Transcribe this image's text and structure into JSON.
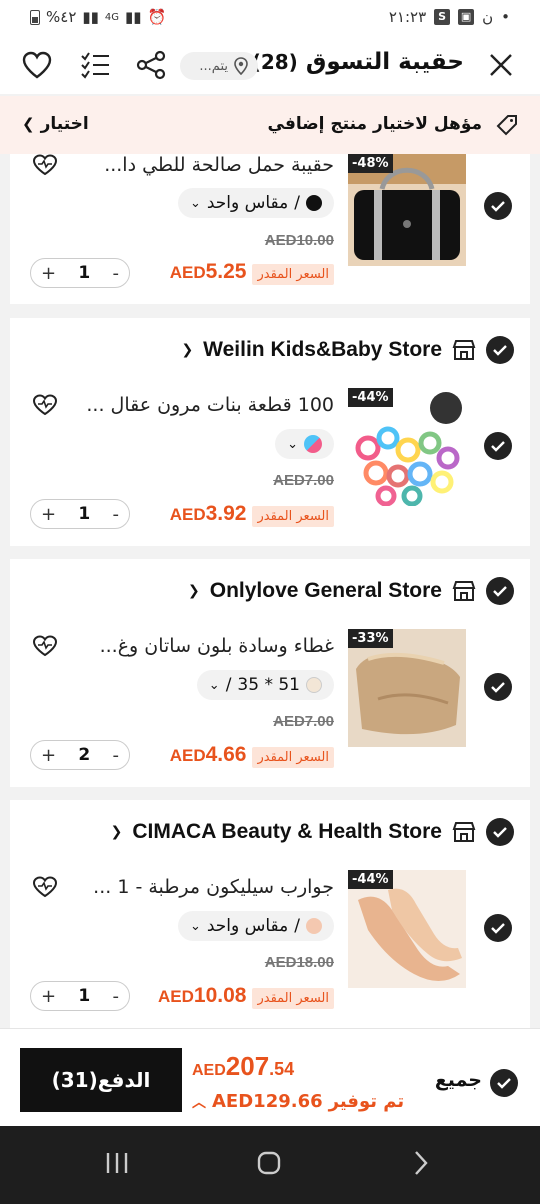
{
  "status_bar": {
    "time": "٢١:٢٣",
    "battery": "%٤٢",
    "signal": "4G"
  },
  "header": {
    "title": "حقيبة التسوق",
    "count": "(28)",
    "location_placeholder": "يتم...",
    "icons": [
      "close-icon",
      "share-icon",
      "list-icon",
      "heart-icon",
      "location-icon"
    ]
  },
  "banner": {
    "text": "مؤهل لاختيار منتج إضافي",
    "choose": "اختيار"
  },
  "items": [
    {
      "title": "حقيبة حمل صالحة للطي دا...",
      "discount": "-48%",
      "variant": "مقاس واحد",
      "variant_sep": "/",
      "original_price": "AED10.00",
      "currency": "AED",
      "price": "5.25",
      "est_label": "السعر المقدر",
      "qty": "1"
    },
    {
      "store": "Weilin Kids&Baby Store",
      "title": "100 قطعة بنات مرون عقال ...",
      "discount": "-44%",
      "original_price": "AED7.00",
      "currency": "AED",
      "price": "3.92",
      "est_label": "السعر المقدر",
      "qty": "1"
    },
    {
      "store": "Onlylove General Store",
      "title": "غطاء وسادة بلون ساتان وغ...",
      "discount": "-33%",
      "variant": "35 * 51",
      "variant_sep": "/",
      "original_price": "AED7.00",
      "currency": "AED",
      "price": "4.66",
      "est_label": "السعر المقدر",
      "qty": "2"
    },
    {
      "store": "CIMACA Beauty & Health Store",
      "title": "جوارب سيليكون مرطبة - 1 ...",
      "discount": "-44%",
      "variant": "مقاس واحد",
      "variant_sep": "/",
      "original_price": "AED18.00",
      "currency": "AED",
      "price": "10.08",
      "est_label": "السعر المقدر",
      "qty": "1"
    }
  ],
  "qty_controls": {
    "minus": "-",
    "plus": "+"
  },
  "footer": {
    "pay_label": "الدفع(31)",
    "total_currency": "AED",
    "total_int": "207",
    "total_dec": ".54",
    "saved_label": "تم توفير",
    "saved_amount": "AED129.66",
    "select_all": "جميع"
  },
  "colors": {
    "accent": "#e8531d",
    "estimate_bg": "#fde4d8",
    "banner_bg": "#fdf0ec",
    "dark": "#111111"
  }
}
